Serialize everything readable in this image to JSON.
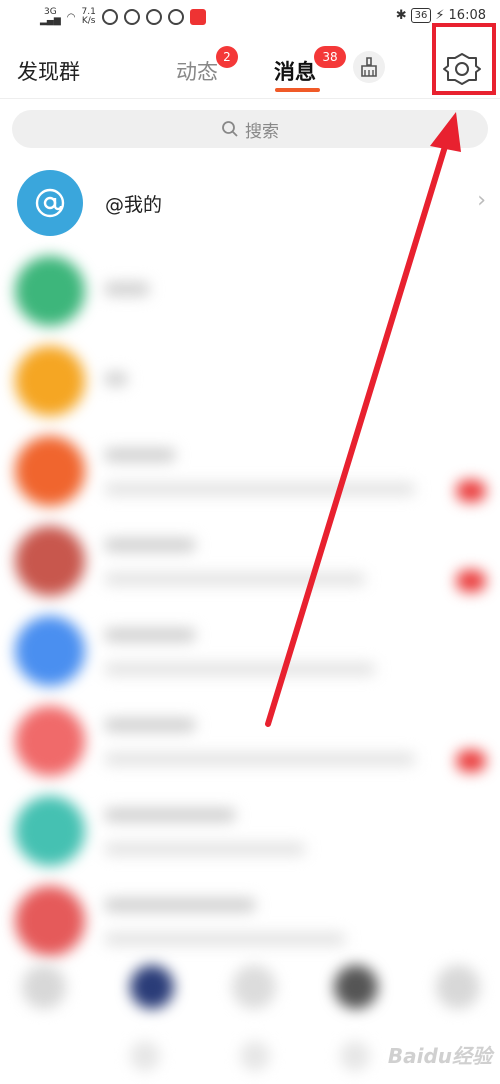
{
  "status_bar": {
    "net_top": "3G",
    "net_speed_value": "7.1",
    "net_speed_unit": "K/s",
    "battery": "36",
    "time": "16:08"
  },
  "header": {
    "left_title": "发现群",
    "tab_dynamic": "动态",
    "tab_dynamic_badge": "2",
    "tab_messages": "消息",
    "tab_messages_badge": "38"
  },
  "search": {
    "placeholder": "搜索"
  },
  "list": {
    "mentions_label": "@我的"
  },
  "watermark": "Baidu经验",
  "colors": {
    "accent": "#f05a28",
    "badge": "#f43838",
    "highlight": "#e8212f",
    "mention_avatar": "#3aa6dc"
  }
}
